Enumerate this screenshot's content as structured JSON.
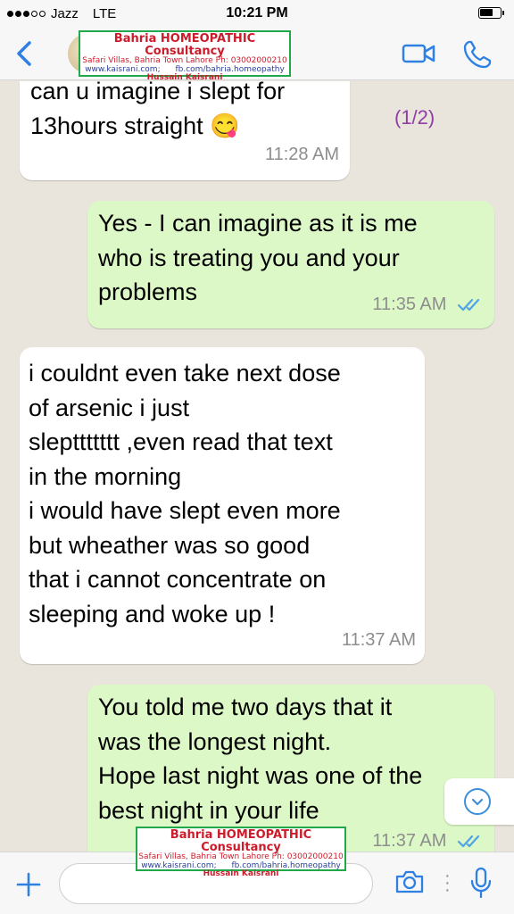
{
  "status_bar": {
    "carrier": "Jazz",
    "network": "LTE",
    "time": "10:21 PM"
  },
  "header": {
    "avatar_icon": "contact-avatar-icon",
    "back_icon": "chevron-left-icon",
    "video_icon": "video-camera-icon",
    "call_icon": "phone-icon",
    "accent_color": "#2f80e3"
  },
  "watermark": {
    "title": "Bahria HOMEOPATHIC Consultancy",
    "address": "Safari Villas, Bahria Town Lahore Ph: 03002000210",
    "website": "www.kaisrani.com;",
    "facebook": "fb.com/bahria.homeopathy",
    "name": "Hussain Kaisrani"
  },
  "messages": [
    {
      "direction": "incoming",
      "text": "can u imagine i slept for\n13hours straight 😋",
      "time": "11:28 AM",
      "counter": "(1/2)"
    },
    {
      "direction": "outgoing",
      "text": "Yes - I can imagine as it is me\nwho is treating you and your\nproblems",
      "time": "11:35 AM",
      "status": "read"
    },
    {
      "direction": "incoming",
      "text": "i couldnt even take next dose\nof arsenic i just\nslepttttttt ,even read that text\nin the morning\ni would have slept even more\nbut wheather was so good\nthat i cannot concentrate on\nsleeping and woke up !",
      "time": "11:37 AM"
    },
    {
      "direction": "outgoing",
      "text": "You told me two days that it\nwas the longest night.\nHope last night was one of the\nbest night in your life",
      "time": "11:37 AM",
      "status": "read"
    }
  ],
  "colors": {
    "incoming_bubble": "#ffffff",
    "outgoing_bubble": "#dcf8c6",
    "read_ticks": "#4fa3e8",
    "chat_background": "#e9e5dc"
  },
  "input_bar": {
    "placeholder": "",
    "value": "",
    "plus_icon": "plus-icon",
    "camera_icon": "camera-icon",
    "mic_icon": "microphone-icon"
  }
}
